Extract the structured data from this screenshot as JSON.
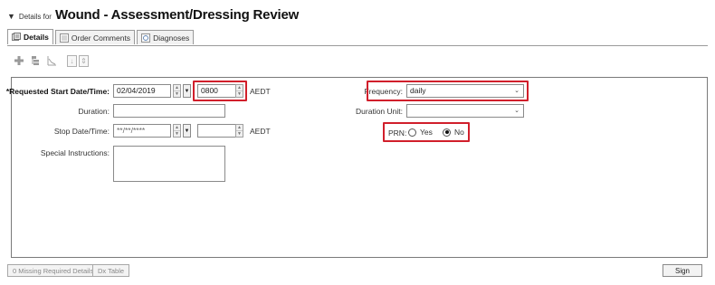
{
  "header": {
    "prefix": "Details for",
    "title": "Wound - Assessment/Dressing Review"
  },
  "tabs": [
    {
      "label": "Details",
      "active": true
    },
    {
      "label": "Order Comments",
      "active": false
    },
    {
      "label": "Diagnoses",
      "active": false
    }
  ],
  "toolbar": {
    "icons": [
      "add-icon",
      "tree-icon",
      "chart-icon",
      "down-icon",
      "sort-icon"
    ]
  },
  "form": {
    "start": {
      "label": "*Requested Start Date/Time:",
      "date": "02/04/2019",
      "time": "0800",
      "tz": "AEDT"
    },
    "duration": {
      "label": "Duration:",
      "value": ""
    },
    "stop": {
      "label": "Stop Date/Time:",
      "date": "**/**/****",
      "time": "",
      "tz": "AEDT"
    },
    "special": {
      "label": "Special Instructions:",
      "value": ""
    },
    "frequency": {
      "label": "Frequency:",
      "value": "daily"
    },
    "duration_unit": {
      "label": "Duration Unit:",
      "value": ""
    },
    "prn": {
      "label": "PRN:",
      "yes": "Yes",
      "no": "No",
      "selected": "No"
    }
  },
  "footer": {
    "missing": "0 Missing Required Details",
    "dx_table": "Dx Table",
    "sign": "Sign"
  },
  "colors": {
    "highlight": "#d11f2b"
  }
}
